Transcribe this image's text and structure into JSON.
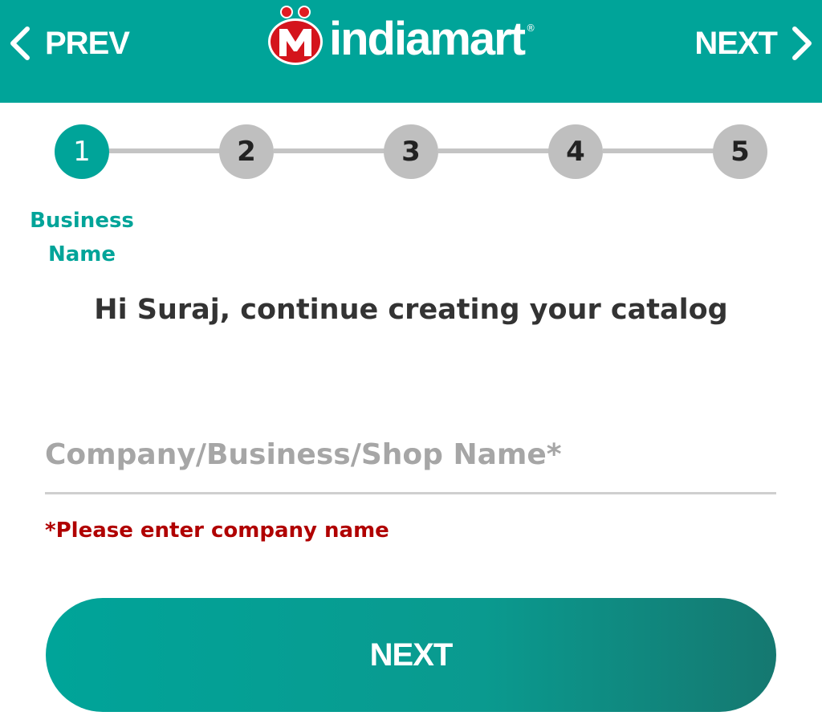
{
  "header": {
    "prev_label": "PREV",
    "next_label": "NEXT",
    "logo_text": "indiamart",
    "logo_reg": "®",
    "bg_color": "#00a499"
  },
  "stepper": {
    "steps": [
      "1",
      "2",
      "3",
      "4",
      "5"
    ],
    "active_index": 0,
    "active_label_line1": "Business",
    "active_label_line2": "Name",
    "active_color": "#00a499",
    "inactive_color": "#bfbfbf"
  },
  "greeting": "Hi Suraj, continue creating your catalog",
  "company_field": {
    "placeholder": "Company/Business/Shop Name*",
    "value": ""
  },
  "error_text": "*Please enter company name",
  "next_button_label": "NEXT",
  "icons": {
    "prev": "chevron-left-icon",
    "next": "chevron-right-icon",
    "logo": "indiamart-m-logo-icon"
  }
}
